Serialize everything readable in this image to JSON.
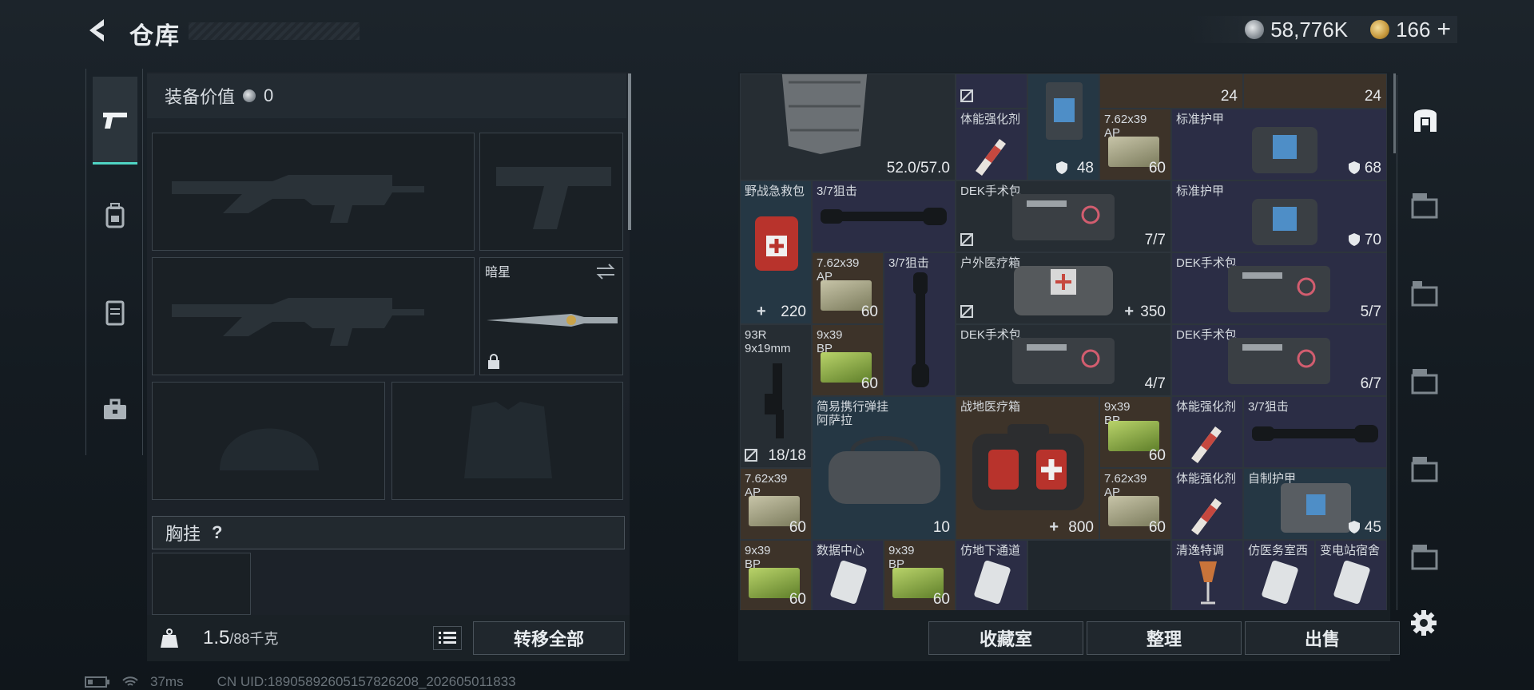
{
  "header": {
    "title": "仓库",
    "back_icon": "chevron-left-icon"
  },
  "currency": {
    "silver": "58,776K",
    "gold": "166",
    "gold_add": "+"
  },
  "left_tabs": [
    {
      "icon": "pistol-icon",
      "active": true
    },
    {
      "icon": "backpack-icon"
    },
    {
      "icon": "armor-icon"
    },
    {
      "icon": "toolbox-icon"
    }
  ],
  "equipment": {
    "value_label": "装备价值",
    "value": "0",
    "melee_name": "暗星",
    "chest_rig_label": "胸挂",
    "help": "?",
    "weight": "1.5",
    "weight_max": "/88千克",
    "transfer_all": "转移全部"
  },
  "inventory": {
    "cells": [
      {
        "id": "vest-top",
        "count": "52.0/57.0"
      },
      {
        "id": "c0a",
        "count": ""
      },
      {
        "id": "c0b",
        "count": ""
      },
      {
        "id": "c0c",
        "count": "24"
      },
      {
        "id": "c0d",
        "count": "24"
      },
      {
        "id": "r1a",
        "name": "体能强化剂"
      },
      {
        "id": "r1b",
        "count": "48"
      },
      {
        "id": "r1c",
        "name": "7.62x39\nAP",
        "count": "60"
      },
      {
        "id": "r1d",
        "name": "标准护甲",
        "count": "68"
      },
      {
        "id": "r2a",
        "name": "野战急救包",
        "count": "220"
      },
      {
        "id": "r2b",
        "name": "3/7狙击"
      },
      {
        "id": "r2c",
        "name": "DEK手术包",
        "count": "7/7"
      },
      {
        "id": "r2d",
        "name": "标准护甲",
        "count": "70"
      },
      {
        "id": "r3a",
        "name": "7.62x39\nAP",
        "count": "60"
      },
      {
        "id": "r3b",
        "name": "3/7狙击"
      },
      {
        "id": "r3c",
        "name": "户外医疗箱",
        "count": "350"
      },
      {
        "id": "r3d",
        "name": "DEK手术包",
        "count": "5/7"
      },
      {
        "id": "r4a",
        "name": "93R\n9x19mm",
        "count": "18/18"
      },
      {
        "id": "r4b",
        "name": "9x39\nBP",
        "count": "60"
      },
      {
        "id": "r4c",
        "name": "DEK手术包",
        "count": "4/7"
      },
      {
        "id": "r4d",
        "name": "DEK手术包",
        "count": "6/7"
      },
      {
        "id": "r5a",
        "name": "简易携行弹挂\n阿萨拉",
        "count": "10"
      },
      {
        "id": "r5b",
        "name": "战地医疗箱",
        "count": "800"
      },
      {
        "id": "r5c",
        "name": "9x39\nBP",
        "count": "60"
      },
      {
        "id": "r5d",
        "name": "体能强化剂"
      },
      {
        "id": "r5e",
        "name": "3/7狙击"
      },
      {
        "id": "r6a",
        "name": "7.62x39\nAP",
        "count": "60"
      },
      {
        "id": "r6b",
        "name": "7.62x39\nAP",
        "count": "60"
      },
      {
        "id": "r6c",
        "name": "体能强化剂"
      },
      {
        "id": "r6d",
        "name": "自制护甲",
        "count": "45"
      },
      {
        "id": "r7a",
        "name": "9x39\nBP",
        "count": "60"
      },
      {
        "id": "r7b",
        "name": "数据中心"
      },
      {
        "id": "r7c",
        "name": "9x39\nBP",
        "count": "60"
      },
      {
        "id": "r7d",
        "name": "仿地下通道"
      },
      {
        "id": "r7e",
        "name": "清逸特调"
      },
      {
        "id": "r7f",
        "name": "仿医务室西"
      },
      {
        "id": "r7g",
        "name": "变电站宿舍"
      }
    ]
  },
  "bottom_buttons": {
    "collection": "收藏室",
    "sort": "整理",
    "sell": "出售"
  },
  "right_tabs": [
    {
      "icon": "vault-icon",
      "active": true
    },
    {
      "icon": "gti-case-icon"
    },
    {
      "icon": "iv-case-icon"
    },
    {
      "icon": "gti-case-2-icon"
    },
    {
      "icon": "gti-case-3-icon"
    },
    {
      "icon": "gii-case-icon"
    },
    {
      "icon": "iv-case-2-icon"
    }
  ],
  "status": {
    "ping": "37ms",
    "uid": "CN UID:18905892605157826208_202605011833"
  }
}
